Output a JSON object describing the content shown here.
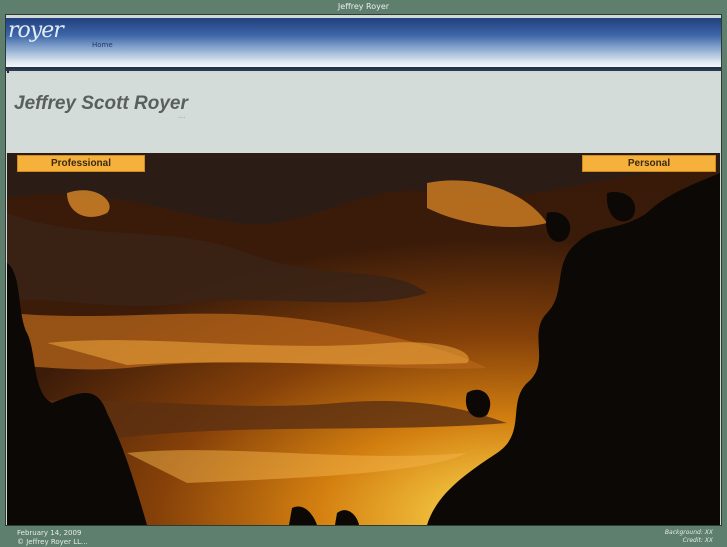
{
  "window": {
    "title": "Jeffrey Royer"
  },
  "header": {
    "logo_text": "royer",
    "nav_home": "Home"
  },
  "hero": {
    "name": "Jeffrey Scott Royer",
    "dots": "...."
  },
  "tabs": {
    "professional": "Professional",
    "personal": "Personal"
  },
  "footer": {
    "date": "February 14, 2009",
    "copyright": "© Jeffrey Royer LL...",
    "background_credit": "Background: XX",
    "credit": "Credit: XX"
  }
}
